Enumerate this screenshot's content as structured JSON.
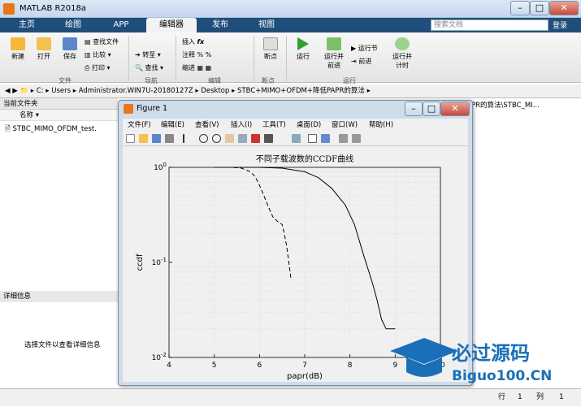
{
  "window": {
    "title": "MATLAB R2018a"
  },
  "tabs": [
    "主页",
    "绘图",
    "APP",
    "编辑器",
    "发布",
    "视图"
  ],
  "search": {
    "placeholder": "搜索文档",
    "login": "登录"
  },
  "ribbon": {
    "new": "新建",
    "open": "打开",
    "save": "保存",
    "find_files": "查找文件",
    "compare": "比较",
    "print": "打印",
    "goto": "转至",
    "find": "查找",
    "insert": "插入",
    "comment": "注释",
    "indent": "缩进",
    "fx": "fx",
    "breakpoints": "断点",
    "run": "运行",
    "run_advance": "运行并\n前进",
    "run_section": "运行节",
    "advance": "前进",
    "run_time": "运行并\n计时",
    "groups": [
      "文件",
      "导航",
      "编辑",
      "断点",
      "运行"
    ]
  },
  "address": {
    "parts": [
      "C:",
      "Users",
      "Administrator.WIN7U-20180127Z",
      "Desktop",
      "STBC+MIMO+OFDM+降低PAPR的算法"
    ]
  },
  "current_folder": {
    "title": "当前文件夹",
    "col_name": "名称",
    "file": "STBC_MIMO_OFDM_test."
  },
  "details": {
    "title": "详细信息",
    "hint": "选择文件以查看详细信息"
  },
  "right_panel": {
    "path": "PR的算法\\STBC_MI..."
  },
  "status": {
    "row_label": "行",
    "row": "1",
    "col_label": "列",
    "col": "1"
  },
  "figure": {
    "title": "Figure 1",
    "menus": [
      "文件(F)",
      "编辑(E)",
      "查看(V)",
      "插入(I)",
      "工具(T)",
      "桌面(D)",
      "窗口(W)",
      "帮助(H)"
    ]
  },
  "chart_data": {
    "type": "line",
    "title": "不同子载波数的CCDF曲线",
    "xlabel": "papr(dB)",
    "ylabel": "ccdf",
    "xlim": [
      4,
      10
    ],
    "ylim": [
      0.01,
      1
    ],
    "yscale": "log",
    "x_ticks": [
      "4",
      "5",
      "6",
      "7",
      "8",
      "9",
      "10"
    ],
    "y_ticks": [
      "10^0",
      "10^-1",
      "10^-2"
    ],
    "grid": true,
    "series": [
      {
        "style": "dashed",
        "x": [
          5.0,
          5.4,
          5.6,
          5.8,
          5.9,
          6.0,
          6.1,
          6.2,
          6.3,
          6.4,
          6.5,
          6.55,
          6.6,
          6.65,
          6.7
        ],
        "y": [
          1,
          1,
          0.98,
          0.9,
          0.8,
          0.65,
          0.5,
          0.38,
          0.3,
          0.27,
          0.25,
          0.2,
          0.15,
          0.1,
          0.065
        ]
      },
      {
        "style": "solid",
        "x": [
          5.0,
          6.0,
          6.5,
          7.0,
          7.3,
          7.6,
          7.9,
          8.1,
          8.3,
          8.5,
          8.6,
          8.7,
          8.8,
          9.0
        ],
        "y": [
          1,
          1,
          0.98,
          0.9,
          0.78,
          0.6,
          0.4,
          0.25,
          0.12,
          0.06,
          0.04,
          0.025,
          0.02,
          0.02
        ]
      }
    ]
  },
  "watermark": {
    "text1": "必过源码",
    "text2": "Biguo100.CN"
  }
}
